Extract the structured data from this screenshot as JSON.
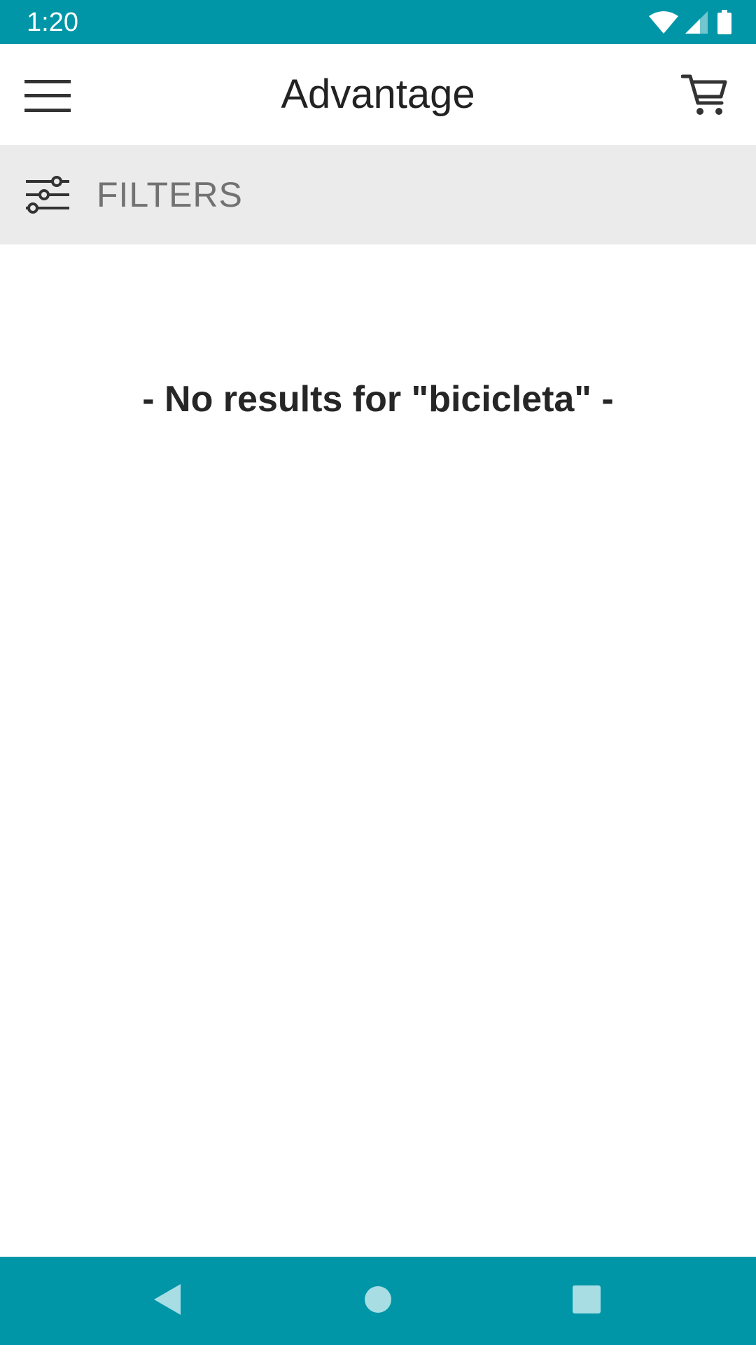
{
  "status_bar": {
    "time": "1:20",
    "icons": [
      "wifi-icon",
      "cell-signal-icon",
      "battery-icon"
    ]
  },
  "app_bar": {
    "title": "Advantage",
    "menu_icon": "hamburger-menu-icon",
    "cart_icon": "shopping-cart-icon"
  },
  "filters": {
    "icon": "sliders-icon",
    "label": "FILTERS"
  },
  "main": {
    "message": "- No results for \"bicicleta\" -"
  },
  "nav_bar": {
    "icons": [
      "back-icon",
      "home-icon",
      "recents-icon"
    ]
  },
  "colors": {
    "primary": "#0096a7",
    "filters_bg": "#ebebeb",
    "text_dark": "#222222",
    "text_muted": "#727272"
  }
}
